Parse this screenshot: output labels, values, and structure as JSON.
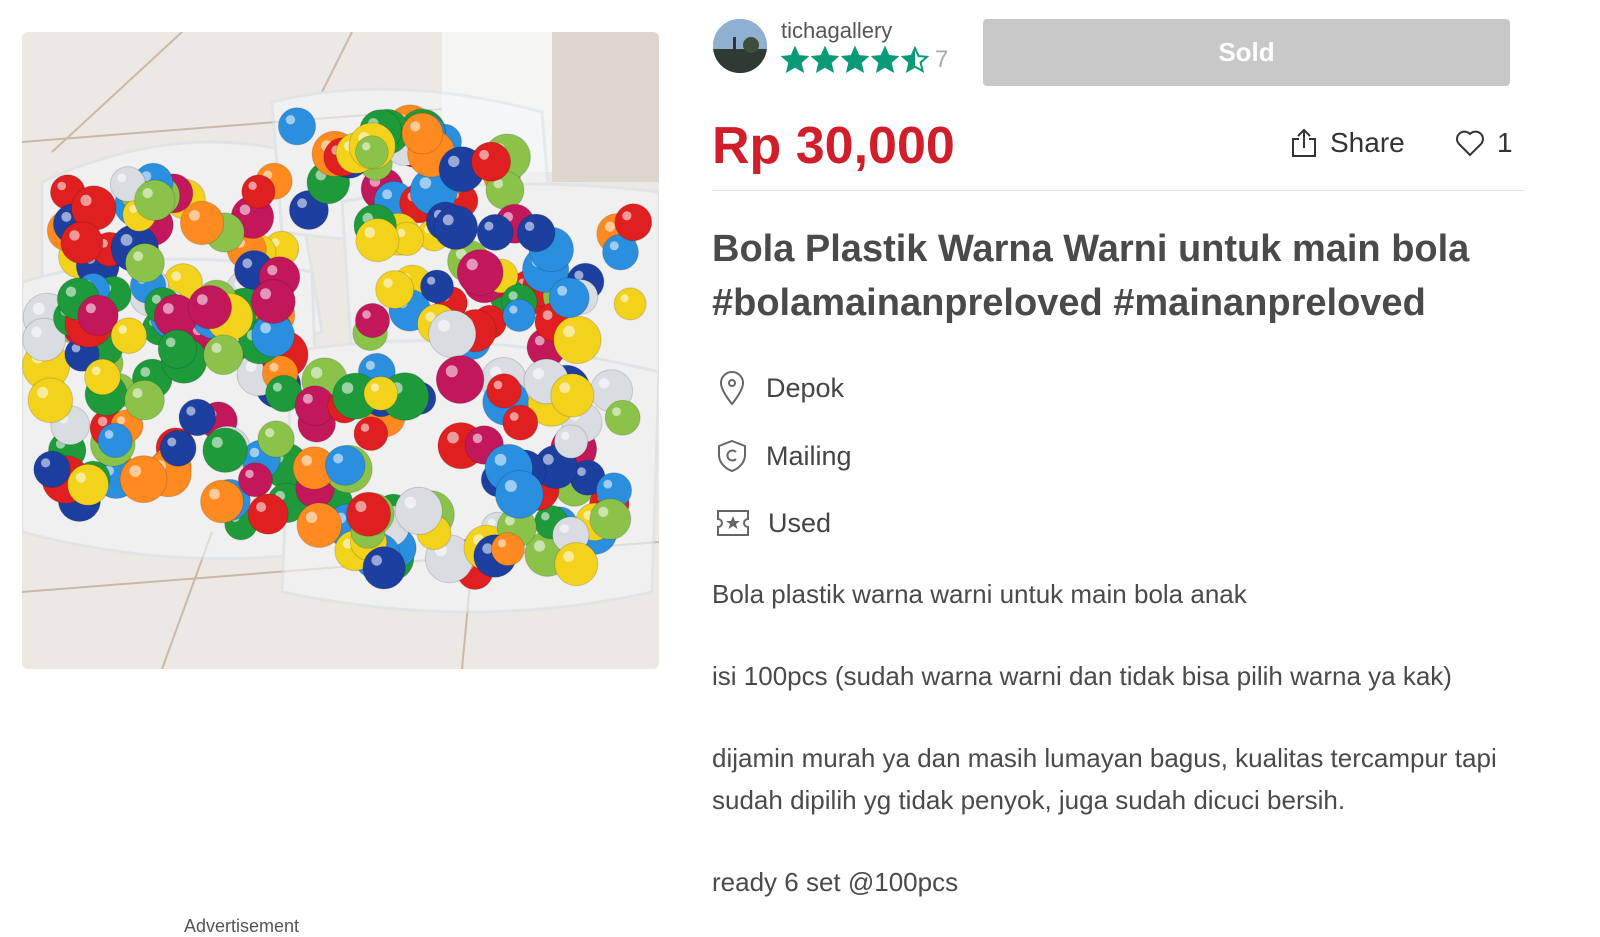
{
  "seller": {
    "username": "tichagallery",
    "rating_stars": 4.5,
    "review_count": "7"
  },
  "status_button": "Sold",
  "price": "Rp 30,000",
  "actions": {
    "share_label": "Share",
    "like_count": "1"
  },
  "title": "Bola Plastik Warna Warni untuk main bola #bolamainanpreloved #mainanpreloved",
  "meta": {
    "location": "Depok",
    "delivery": "Mailing",
    "condition": "Used"
  },
  "description": {
    "line1": "Bola plastik warna warni untuk main bola anak",
    "line2": "isi 100pcs (sudah warna warni dan tidak bisa pilih warna ya kak)",
    "line3": "dijamin murah ya dan masih lumayan bagus, kualitas tercampur tapi sudah dipilih yg tidak penyok, juga sudah dicuci bersih.",
    "line4": "ready 6 set @100pcs"
  },
  "advertisement_label": "Advertisement",
  "colors": {
    "price": "#d01f2b",
    "star": "#0a9a78",
    "sold_button": "#c8c8c8"
  },
  "icons": [
    "star-icon",
    "share-icon",
    "heart-icon",
    "location-pin-icon",
    "shield-c-icon",
    "ticket-star-icon"
  ]
}
